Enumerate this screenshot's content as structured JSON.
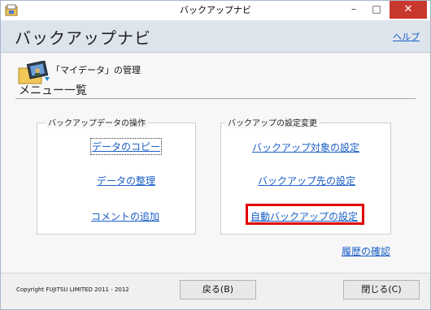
{
  "window": {
    "title": "バックアップナビ",
    "minimize_glyph": "–",
    "maximize_glyph": "□",
    "close_glyph": "✕"
  },
  "header": {
    "title": "バックアップナビ",
    "help_label": "ヘルプ"
  },
  "context": {
    "label": "「マイデータ」の管理"
  },
  "menu": {
    "heading": "メニュー一覧"
  },
  "groups": {
    "data_ops": {
      "legend": "バックアップデータの操作",
      "copy": "データのコピー",
      "organize": "データの整理",
      "comment": "コメントの追加"
    },
    "settings": {
      "legend": "バックアップの設定変更",
      "target": "バックアップ対象の設定",
      "destination": "バックアップ先の設定",
      "auto": "自動バックアップの設定"
    }
  },
  "history_label": "履歴の確認",
  "footer": {
    "copyright": "Copyright FUJITSU LIMITED 2011 - 2012",
    "back_label": "戻る(B)",
    "close_label": "閉じる(C)"
  },
  "colors": {
    "link": "#1a5fc8",
    "highlight": "#e00000",
    "header_bg": "#dde4ec"
  }
}
